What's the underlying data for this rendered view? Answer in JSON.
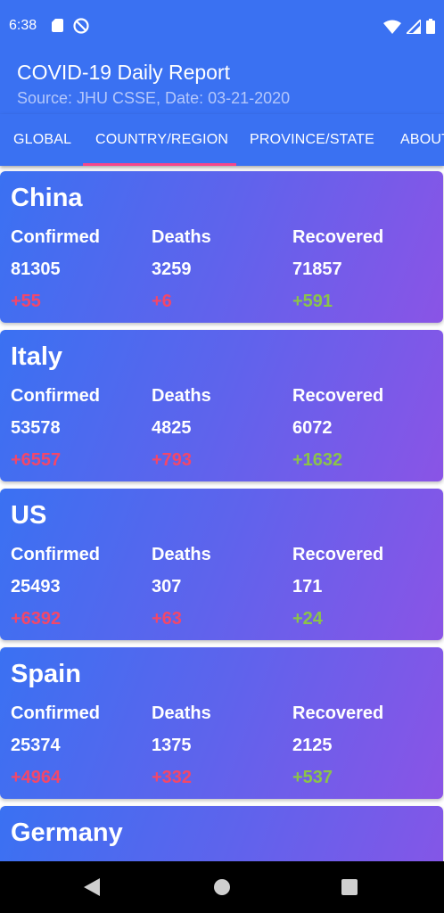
{
  "status_bar": {
    "time": "6:38"
  },
  "app": {
    "title": "COVID-19 Daily Report",
    "subtitle": "Source: JHU CSSE, Date: 03-21-2020"
  },
  "tabs": [
    {
      "label": "GLOBAL",
      "selected": false
    },
    {
      "label": "COUNTRY/REGION",
      "selected": true
    },
    {
      "label": "PROVINCE/STATE",
      "selected": false
    },
    {
      "label": "ABOUT",
      "selected": false
    }
  ],
  "labels": {
    "confirmed": "Confirmed",
    "deaths": "Deaths",
    "recovered": "Recovered"
  },
  "countries": [
    {
      "name": "China",
      "confirmed": "81305",
      "deaths": "3259",
      "recovered": "71857",
      "confirmed_delta": "+55",
      "deaths_delta": "+6",
      "recovered_delta": "+591"
    },
    {
      "name": "Italy",
      "confirmed": "53578",
      "deaths": "4825",
      "recovered": "6072",
      "confirmed_delta": "+6557",
      "deaths_delta": "+793",
      "recovered_delta": "+1632"
    },
    {
      "name": "US",
      "confirmed": "25493",
      "deaths": "307",
      "recovered": "171",
      "confirmed_delta": "+6392",
      "deaths_delta": "+63",
      "recovered_delta": "+24"
    },
    {
      "name": "Spain",
      "confirmed": "25374",
      "deaths": "1375",
      "recovered": "2125",
      "confirmed_delta": "+4964",
      "deaths_delta": "+332",
      "recovered_delta": "+537"
    },
    {
      "name": "Germany"
    }
  ],
  "colors": {
    "primary": "#3a71f2",
    "accent": "#f7468a",
    "increase_red": "#f2476a",
    "increase_green": "#8bc34a"
  },
  "icons": [
    "sd-card-icon",
    "do-not-disturb-icon",
    "wifi-icon",
    "signal-icon",
    "battery-icon",
    "back-icon",
    "home-icon",
    "recents-icon"
  ]
}
